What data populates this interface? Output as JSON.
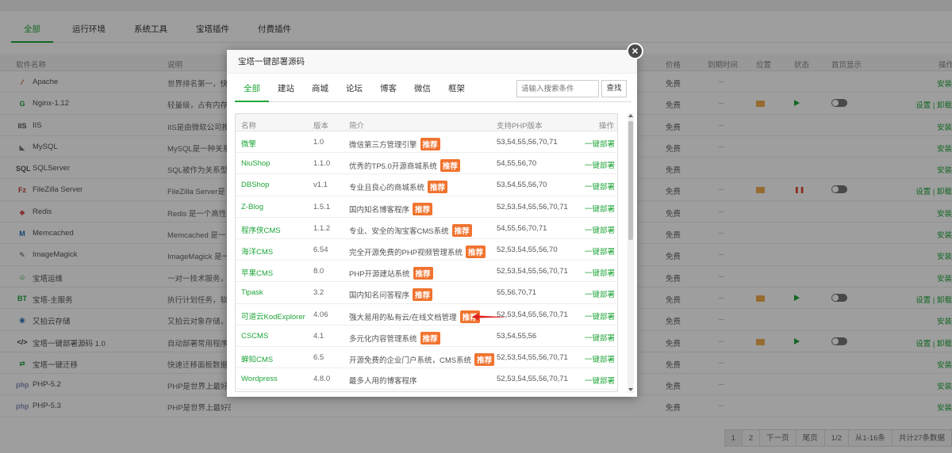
{
  "bg": {
    "tabs": [
      "全部",
      "运行环境",
      "系统工具",
      "宝塔插件",
      "付费插件"
    ],
    "columns": [
      "软件名称",
      "说明",
      "价格",
      "到期时间",
      "位置",
      "状态",
      "首页显示",
      "操作"
    ],
    "rows": [
      {
        "icon": "apache-icon",
        "glyph": "⁄",
        "name": "Apache",
        "desc": "世界排名第一，快",
        "price": "免费",
        "expire": "--",
        "op": "安装"
      },
      {
        "icon": "nginx-icon",
        "glyph": "G",
        "name": "Nginx-1.12",
        "desc": "轻量级，占有内存",
        "price": "免费",
        "expire": "--",
        "op": "设置 | 卸载"
      },
      {
        "icon": "iis-icon",
        "glyph": "IIS",
        "name": "IIS",
        "desc": "IIS是由微软公司推",
        "price": "免费",
        "expire": "--",
        "op": "安装"
      },
      {
        "icon": "mysql-icon",
        "glyph": "◣",
        "name": "MySQL",
        "desc": "MySQL是一种关系",
        "price": "免费",
        "expire": "--",
        "op": "安装"
      },
      {
        "icon": "sqlserver-icon",
        "glyph": "SQL",
        "name": "SQLServer",
        "desc": "SQL被作为关系型",
        "price": "免费",
        "expire": "",
        "op": "安装"
      },
      {
        "icon": "filezilla-icon",
        "glyph": "Fz",
        "name": "FileZilla Server",
        "desc": "FileZilla Server是",
        "price": "免费",
        "expire": "--",
        "op": "设置 | 卸载"
      },
      {
        "icon": "redis-icon",
        "glyph": "◆",
        "name": "Redis",
        "desc": "Redis 是一个高性",
        "price": "免费",
        "expire": "--",
        "op": "安装"
      },
      {
        "icon": "memcached-icon",
        "glyph": "M",
        "name": "Memcached",
        "desc": "Memcached 是一",
        "price": "免费",
        "expire": "--",
        "op": "安装"
      },
      {
        "icon": "imagemagick-icon",
        "glyph": "✎",
        "name": "ImageMagick",
        "desc": "ImageMagick 是一",
        "price": "免费",
        "expire": "--",
        "op": "安装"
      },
      {
        "icon": "support-icon",
        "glyph": "☺",
        "name": "宝塔运维",
        "desc": "一对一技术服务，",
        "price": "免费",
        "expire": "--",
        "op": "安装"
      },
      {
        "icon": "bt-icon",
        "glyph": "BT",
        "name": "宝塔-主服务",
        "desc": "执行计划任务，软",
        "price": "免费",
        "expire": "--",
        "op": "设置 | 卸载"
      },
      {
        "icon": "upyun-icon",
        "glyph": "◉",
        "name": "又拍云存储",
        "desc": "又拍云对象存储，",
        "price": "免费",
        "expire": "--",
        "op": "安装"
      },
      {
        "icon": "code-icon",
        "glyph": "</>",
        "name": "宝塔一键部署源码 1.0",
        "desc": "自动部署常用程序",
        "price": "免费",
        "expire": "--",
        "op": "设置 | 卸载"
      },
      {
        "icon": "migrate-icon",
        "glyph": "⇄",
        "name": "宝塔一键迁移",
        "desc": "快速迁移面板数据",
        "price": "免费",
        "expire": "--",
        "op": "安装"
      },
      {
        "icon": "php-icon",
        "glyph": "php",
        "name": "PHP-5.2",
        "desc": "PHP是世界上最好",
        "price": "免费",
        "expire": "--",
        "op": "安装"
      },
      {
        "icon": "php-icon",
        "glyph": "php",
        "name": "PHP-5.3",
        "desc": "PHP是世界上最好的编程语言",
        "price": "免费",
        "expire": "--",
        "op": "安装"
      }
    ],
    "pager": [
      "1",
      "2",
      "下一页",
      "尾页",
      "1/2",
      "从1-16条",
      "共计27条数据"
    ]
  },
  "modal": {
    "title": "宝塔一键部署源码",
    "close": "×",
    "tabs": [
      "全部",
      "建站",
      "商城",
      "论坛",
      "博客",
      "微信",
      "框架"
    ],
    "search_placeholder": "请输入搜索条件",
    "search_button": "查找",
    "columns": [
      "名称",
      "版本",
      "简介",
      "支持PHP版本",
      "操作"
    ],
    "badge": "推荐",
    "rows": [
      {
        "name": "微擎",
        "ver": "1.0",
        "desc": "微信第三方管理引擎",
        "rec": true,
        "php": "53,54,55,56,70,71",
        "op": "一键部署"
      },
      {
        "name": "NiuShop",
        "ver": "1.1.0",
        "desc": "优秀的TP5.0开源商城系统",
        "rec": true,
        "php": "54,55,56,70",
        "op": "一键部署"
      },
      {
        "name": "DBShop",
        "ver": "v1.1",
        "desc": "专业且良心的商城系统",
        "rec": true,
        "php": "53,54,55,56,70",
        "op": "一键部署"
      },
      {
        "name": "Z-Blog",
        "ver": "1.5.1",
        "desc": "国内知名博客程序",
        "rec": true,
        "php": "52,53,54,55,56,70,71",
        "op": "一键部署"
      },
      {
        "name": "程序侠CMS",
        "ver": "1.1.2",
        "desc": "专业、安全的淘宝客CMS系统",
        "rec": true,
        "php": "54,55,56,70,71",
        "op": "一键部署"
      },
      {
        "name": "海洋CMS",
        "ver": "6.54",
        "desc": "完全开源免费的PHP视频管理系统",
        "rec": true,
        "php": "52,53,54,55,56,70",
        "op": "一键部署"
      },
      {
        "name": "苹果CMS",
        "ver": "8.0",
        "desc": "PHP开源建站系统",
        "rec": true,
        "php": "52,53,54,55,56,70,71",
        "op": "一键部署"
      },
      {
        "name": "Tipask",
        "ver": "3.2",
        "desc": "国内知名问答程序",
        "rec": true,
        "php": "55,56,70,71",
        "op": "一键部署"
      },
      {
        "name": "可道云KodExplorer",
        "ver": "4.06",
        "desc": "强大易用的私有云/在线文档管理",
        "rec": true,
        "php": "52,53,54,55,56,70,71",
        "op": "一键部署"
      },
      {
        "name": "CSCMS",
        "ver": "4.1",
        "desc": "多元化内容管理系统",
        "rec": true,
        "php": "53,54,55,56",
        "op": "一键部署"
      },
      {
        "name": "蝉知CMS",
        "ver": "6.5",
        "desc": "开源免费的企业门户系统，CMS系统",
        "rec": true,
        "php": "52,53,54,55,56,70,71",
        "op": "一键部署"
      },
      {
        "name": "Wordpress",
        "ver": "4.8.0",
        "desc": "最多人用的博客程序",
        "rec": false,
        "php": "52,53,54,55,56,70,71",
        "op": "一键部署"
      }
    ]
  },
  "colors": {
    "accent": "#20a53a",
    "badge": "#f0732f",
    "arrow": "#e02020"
  }
}
